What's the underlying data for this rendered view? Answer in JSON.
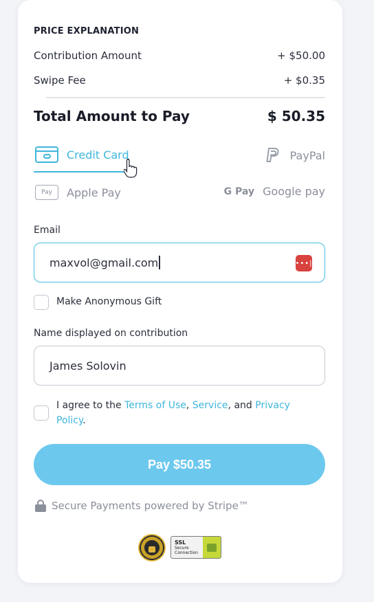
{
  "price_explanation": {
    "heading": "PRICE EXPLANATION",
    "rows": [
      {
        "label": "Contribution Amount",
        "value": "+ $50.00"
      },
      {
        "label": "Swipe Fee",
        "value": "+ $0.35"
      }
    ],
    "total_label": "Total Amount to Pay",
    "total_value": "$ 50.35"
  },
  "payment_methods": [
    {
      "label": "Credit Card",
      "icon": "credit-card-icon",
      "selected": true
    },
    {
      "label": "PayPal",
      "icon": "paypal-icon",
      "selected": false
    },
    {
      "label": "Apple Pay",
      "icon": "apple-pay-icon",
      "selected": false
    },
    {
      "label": "Google pay",
      "icon": "google-pay-icon",
      "selected": false
    }
  ],
  "icon_text": {
    "apple_pay": "Pay",
    "google_pay": "G Pay",
    "password_manager": "•••|"
  },
  "email": {
    "label": "Email",
    "value": "maxvol@gmail.com"
  },
  "anonymous": {
    "label": "Make Anonymous Gift",
    "checked": false
  },
  "display_name": {
    "label": "Name displayed on contribution",
    "value": "James Solovin"
  },
  "agree": {
    "prefix": "I agree to the ",
    "terms": "Terms of Use",
    "sep1": ", ",
    "service": "Service",
    "sep2": ", and ",
    "privacy": "Privacy Policy",
    "suffix": ".",
    "checked": false
  },
  "pay_button": "Pay $50.35",
  "secure_text": "Secure Payments powered by Stripe™",
  "ssl_badge": {
    "line1": "SSL",
    "line2": "Secure",
    "line3": "Connection"
  },
  "colors": {
    "accent": "#3fb6dc",
    "pay_button": "#6dc8ee",
    "password_icon": "#d8423f"
  }
}
